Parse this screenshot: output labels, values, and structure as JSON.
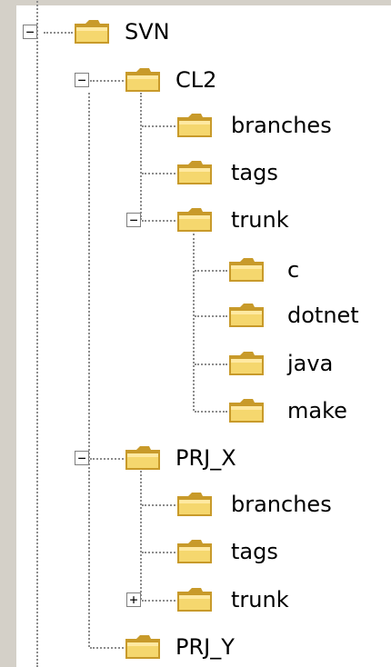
{
  "tree": {
    "items": [
      {
        "label": "SVN",
        "depth": 0,
        "toggle": "−"
      },
      {
        "label": "CL2",
        "depth": 1,
        "toggle": "−"
      },
      {
        "label": "branches",
        "depth": 2,
        "toggle": ""
      },
      {
        "label": "tags",
        "depth": 2,
        "toggle": ""
      },
      {
        "label": "trunk",
        "depth": 2,
        "toggle": "−"
      },
      {
        "label": "c",
        "depth": 3,
        "toggle": ""
      },
      {
        "label": "dotnet",
        "depth": 3,
        "toggle": ""
      },
      {
        "label": "java",
        "depth": 3,
        "toggle": ""
      },
      {
        "label": "make",
        "depth": 3,
        "toggle": ""
      },
      {
        "label": "PRJ_X",
        "depth": 1,
        "toggle": "−"
      },
      {
        "label": "branches",
        "depth": 2,
        "toggle": ""
      },
      {
        "label": "tags",
        "depth": 2,
        "toggle": ""
      },
      {
        "label": "trunk",
        "depth": 2,
        "toggle": "+"
      },
      {
        "label": "PRJ_Y",
        "depth": 1,
        "toggle": ""
      }
    ]
  },
  "colors": {
    "folder_fill": "#f5d76e",
    "folder_edge": "#c89a2a",
    "panel_bg": "#d4d0c8",
    "line": "#8c8c8c"
  }
}
